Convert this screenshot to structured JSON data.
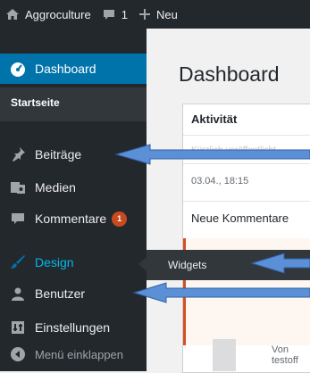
{
  "adminbar": {
    "site_name": "Aggroculture",
    "comments_count": "1",
    "new_label": "Neu",
    "icons": [
      "home-icon",
      "comment-bubble-icon",
      "plus-icon"
    ]
  },
  "sidebar": {
    "items": [
      {
        "label": "Dashboard",
        "icon": "dashboard-icon"
      },
      {
        "label": "Beiträge",
        "icon": "pin-icon"
      },
      {
        "label": "Medien",
        "icon": "media-icon"
      },
      {
        "label": "Kommentare",
        "icon": "comment-icon",
        "badge": "1"
      },
      {
        "label": "Design",
        "icon": "brush-icon"
      },
      {
        "label": "Benutzer",
        "icon": "users-icon"
      },
      {
        "label": "Einstellungen",
        "icon": "settings-icon"
      },
      {
        "label": "Menü einklappen",
        "icon": "collapse-icon"
      }
    ],
    "submenu_label": "Startseite",
    "flyout_label": "Widgets"
  },
  "main": {
    "title": "Dashboard",
    "panel_title": "Aktivität",
    "faded_text": "Kürzlich veröffentlicht",
    "date": "03.04., 18:15",
    "new_comments": "Neue Kommentare",
    "bottom_text": "Von testoff"
  },
  "colors": {
    "adminbar_bg": "#23282d",
    "active_blue": "#0073aa",
    "badge": "#ca4a1f",
    "callout_arrow": "#5b8fd6"
  }
}
